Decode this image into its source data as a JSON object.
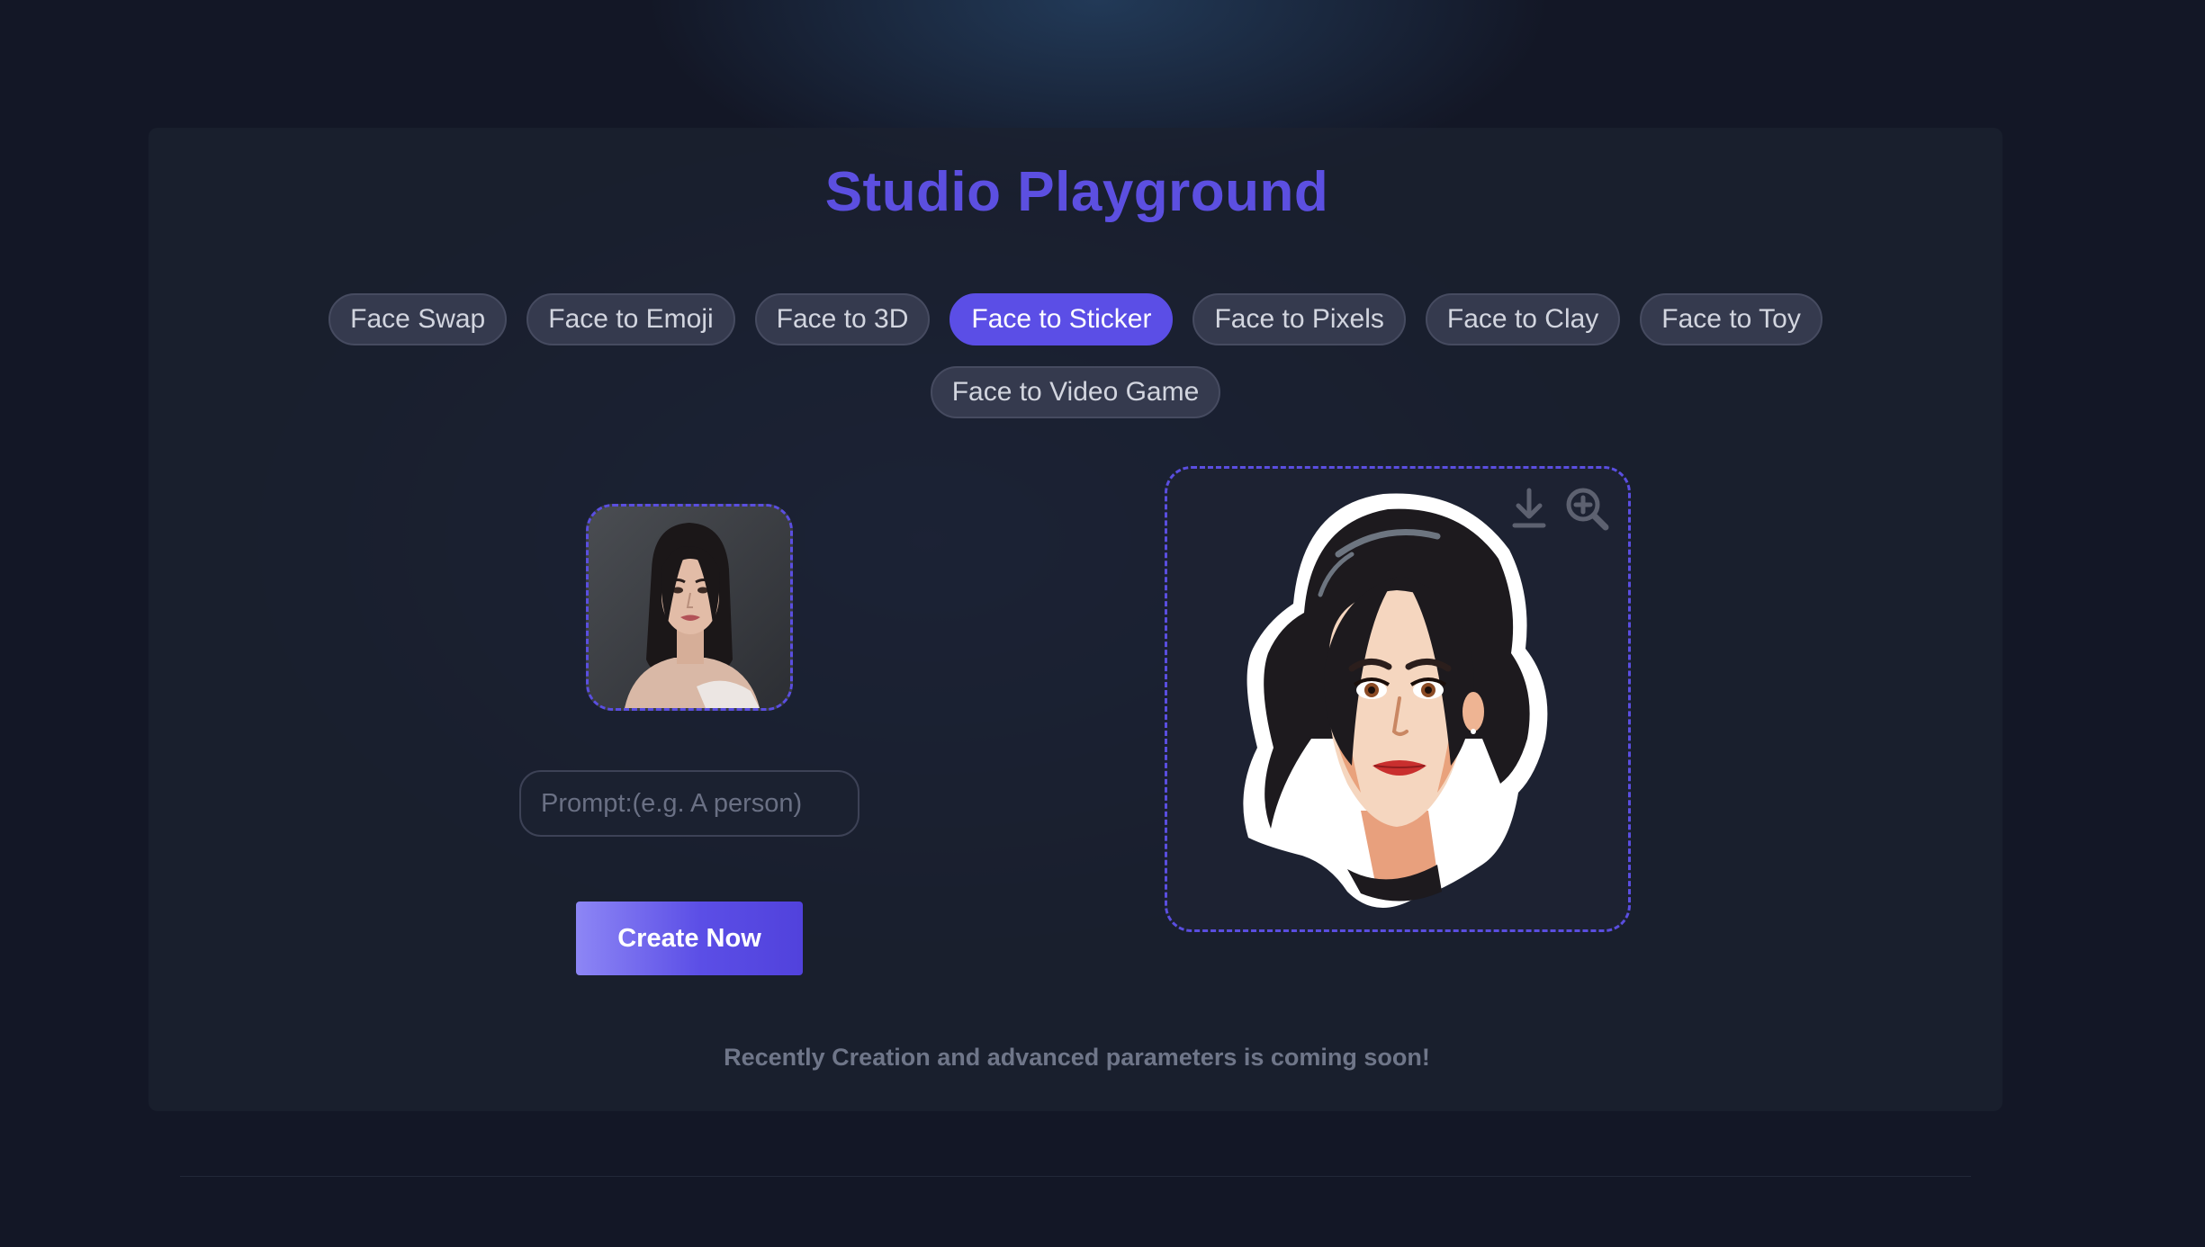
{
  "header": {
    "title": "Studio Playground"
  },
  "tabs": [
    {
      "label": "Face Swap",
      "active": false
    },
    {
      "label": "Face to Emoji",
      "active": false
    },
    {
      "label": "Face to 3D",
      "active": false
    },
    {
      "label": "Face to Sticker",
      "active": true
    },
    {
      "label": "Face to Pixels",
      "active": false
    },
    {
      "label": "Face to Clay",
      "active": false
    },
    {
      "label": "Face to Toy",
      "active": false
    },
    {
      "label": "Face to Video Game",
      "active": false
    }
  ],
  "input": {
    "prompt_placeholder": "Prompt:(e.g. A person)",
    "prompt_value": ""
  },
  "actions": {
    "create_label": "Create Now"
  },
  "result": {
    "icons": [
      "download-icon",
      "zoom-in-icon"
    ]
  },
  "footer": {
    "note": "Recently Creation and advanced parameters is coming soon!"
  },
  "colors": {
    "accent": "#5b4ee6",
    "background": "#131726",
    "card": "#1b2130",
    "tab_inactive": "#353a4e"
  }
}
